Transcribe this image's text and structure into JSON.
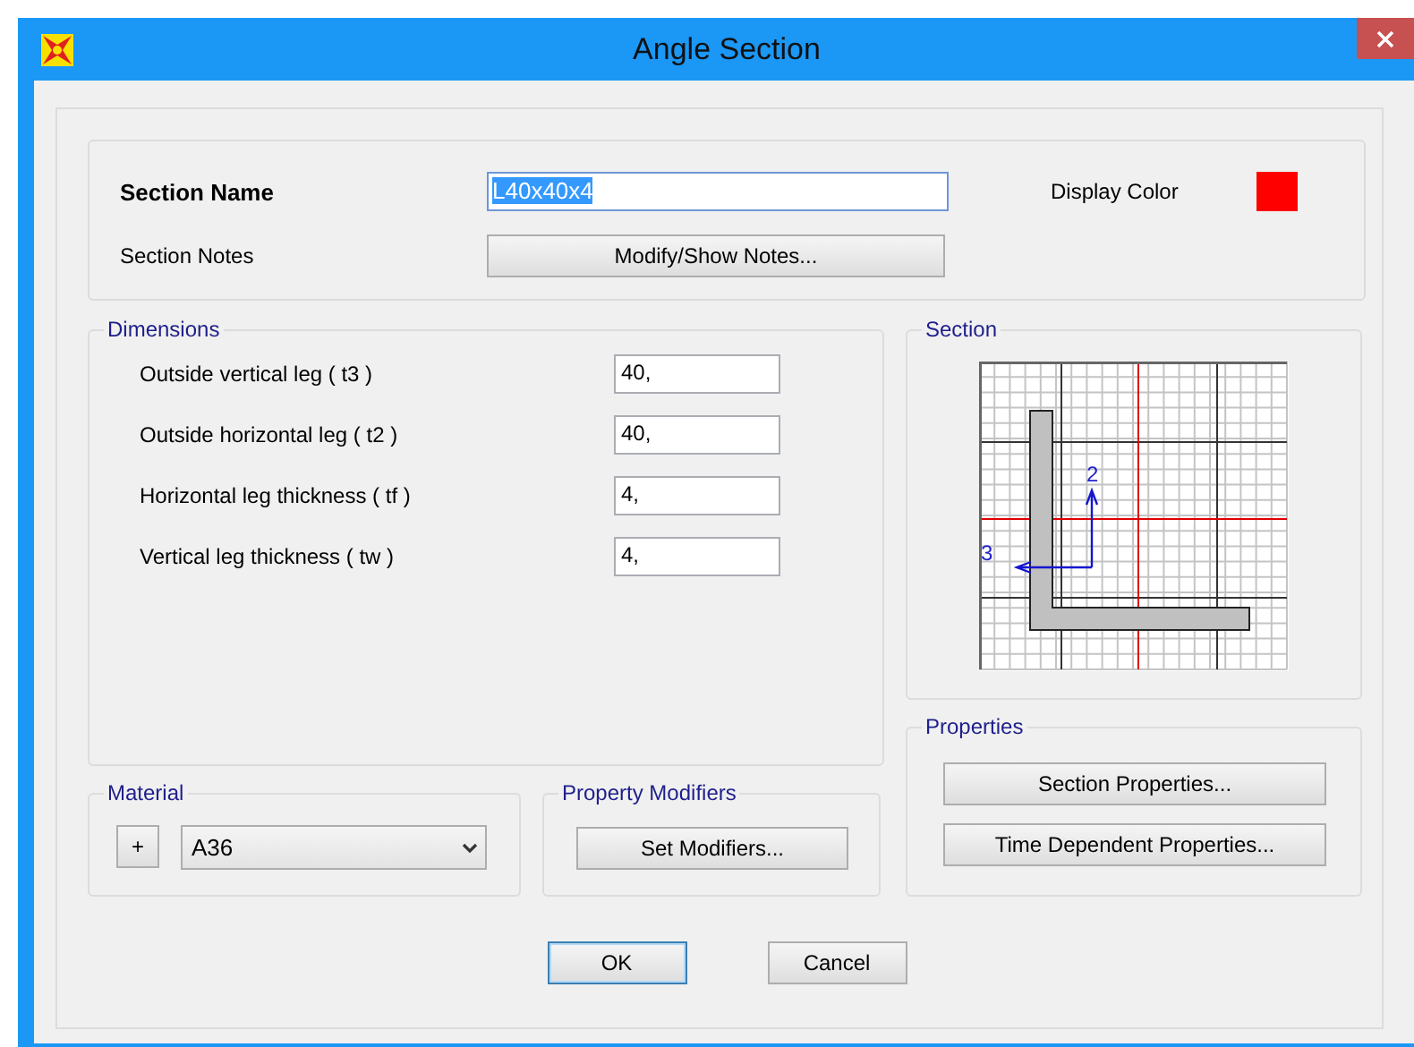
{
  "window": {
    "title": "Angle Section"
  },
  "section_name": {
    "label": "Section Name",
    "value": "L40x40x4",
    "text_selected": true
  },
  "display_color": {
    "label": "Display Color",
    "color": "#ff0000"
  },
  "section_notes": {
    "label": "Section Notes",
    "button": "Modify/Show Notes..."
  },
  "dimensions": {
    "title": "Dimensions",
    "fields": [
      {
        "label": "Outside vertical leg ( t3 )",
        "value": "40,"
      },
      {
        "label": "Outside horizontal leg ( t2 )",
        "value": "40,"
      },
      {
        "label": "Horizontal leg thickness ( tf )",
        "value": "4,"
      },
      {
        "label": "Vertical leg thickness ( tw )",
        "value": "4,"
      }
    ]
  },
  "section_preview": {
    "title": "Section",
    "axis_labels": [
      "2",
      "3"
    ]
  },
  "properties": {
    "title": "Properties",
    "buttons": [
      "Section Properties...",
      "Time Dependent Properties..."
    ]
  },
  "material": {
    "title": "Material",
    "add_button": "+",
    "value": "A36"
  },
  "property_modifiers": {
    "title": "Property Modifiers",
    "button": "Set Modifiers..."
  },
  "buttons": [
    {
      "label": "OK",
      "default": true
    },
    {
      "label": "Cancel",
      "default": false
    }
  ]
}
